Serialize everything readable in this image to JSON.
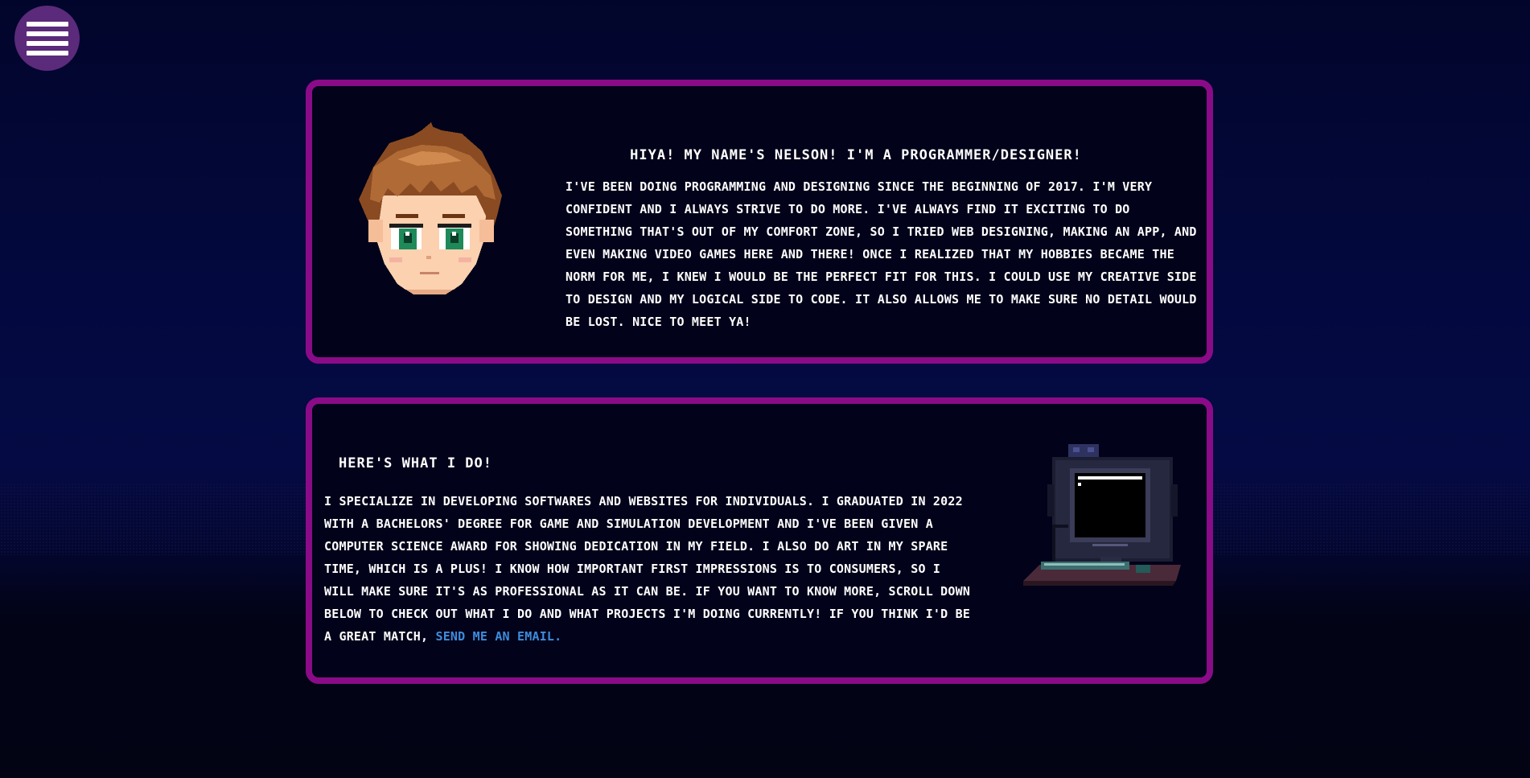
{
  "nav": {
    "menu_icon": "hamburger-menu-icon"
  },
  "about": {
    "heading": "Hiya! My name's Nelson! I'm a programmer/designer!",
    "text": "I've been doing programming and designing since the beginning of 2017. I'm very confident and I always strive to do more. I've always find it exciting to do something that's out of my comfort zone, so I tried web designing, making an app, and even making video games here and there! Once I realized that my hobbies became the norm for me, I knew I would be the perfect fit for this. I could use my creative side to design and my logical side to code. It also allows me to make sure no detail would be lost. Nice to meet ya!",
    "avatar_icon": "pixel-avatar-portrait"
  },
  "what_i_do": {
    "heading": "Here's what I do!",
    "text": "I specialize in developing softwares and websites for individuals. I graduated in 2022 with a bachelors' degree for Game and Simulation Development and I've been given a computer science award for showing dedication in my field. I also do art in my spare time, which is a plus! I know how important first impressions is to consumers, so I will make sure it's as professional as it can be. If you want to know more, scroll down below to check out what I do and what projects I'm doing currently! If you think I'd be a great match,",
    "link_label": "send me an email.",
    "computer_icon": "pixel-computer-illustration"
  },
  "colors": {
    "panel_border": "#8a0b87",
    "panel_bg": "#02031a",
    "menu_button": "#5c2a7a",
    "link": "#3f8cdc"
  }
}
